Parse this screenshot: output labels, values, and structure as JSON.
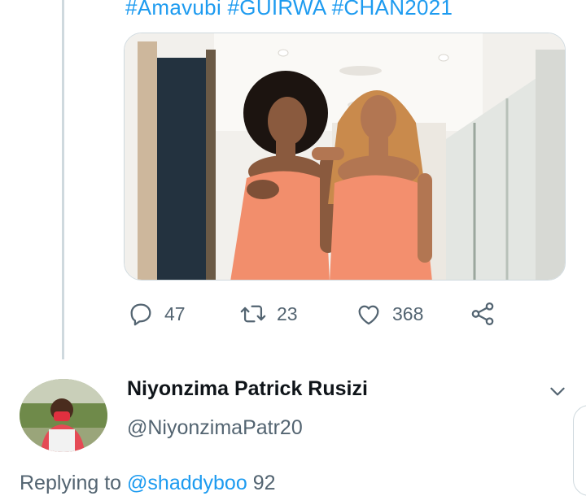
{
  "tweet": {
    "hashtags": "#Amavubi #GUIRWA #CHAN2021",
    "media": {
      "alt": "Two women wrapped in peach towels in a hallway",
      "colors": {
        "towel": "#f28e6c",
        "wall": "#f2f0ec",
        "door": "#23323f",
        "ceiling": "#faf9f6"
      }
    },
    "actions": {
      "reply": {
        "icon": "reply-icon",
        "count": "47"
      },
      "retweet": {
        "icon": "retweet-icon",
        "count": "23"
      },
      "like": {
        "icon": "heart-icon",
        "count": "368"
      },
      "share": {
        "icon": "share-icon"
      }
    }
  },
  "reply": {
    "display_name": "Niyonzima Patrick Rusizi",
    "handle": "@NiyonzimaPatr20",
    "replying_prefix": "Replying to ",
    "replying_mention": "@shaddyboo",
    "replying_suffix": " 92"
  },
  "colors": {
    "accent": "#1d9bf0",
    "muted": "#536471",
    "border": "#cfd9de",
    "text": "#0f1419"
  }
}
